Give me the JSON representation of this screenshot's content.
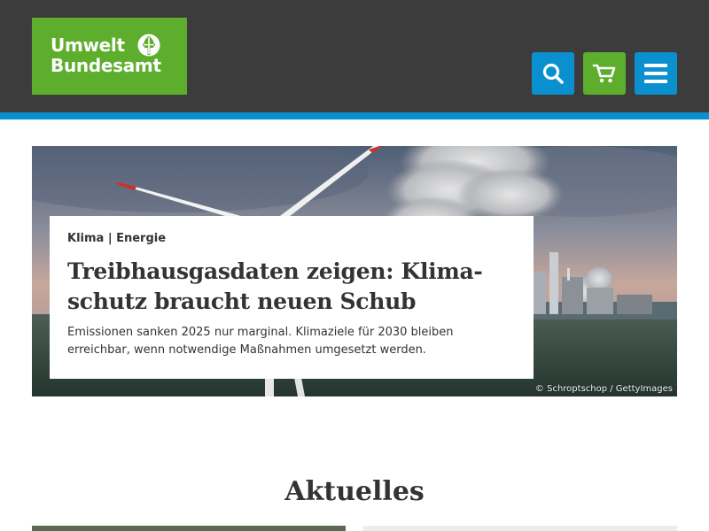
{
  "header": {
    "logo": {
      "line1": "Umwelt",
      "line2": "Bundesamt"
    },
    "colors": {
      "bar": "#3d3c3c",
      "accent_blue": "#0b90cf",
      "accent_green": "#5eae2e"
    },
    "buttons": [
      {
        "name": "search",
        "icon": "search-icon"
      },
      {
        "name": "cart",
        "icon": "cart-icon"
      },
      {
        "name": "menu",
        "icon": "hamburger-icon"
      }
    ]
  },
  "hero": {
    "kicker": "Klima | Energie",
    "title": "Treibhausgasdaten zeigen: Klima­schutz braucht neuen Schub",
    "text": "Emissionen sanken 2025 nur marginal. Klimaziele für 2030 bleiben erreichbar, wenn notwendige Maßnahmen umgesetzt werden.",
    "credit": "© Schroptschop / GettyImages"
  },
  "aktuelles": {
    "heading": "Aktuelles"
  }
}
